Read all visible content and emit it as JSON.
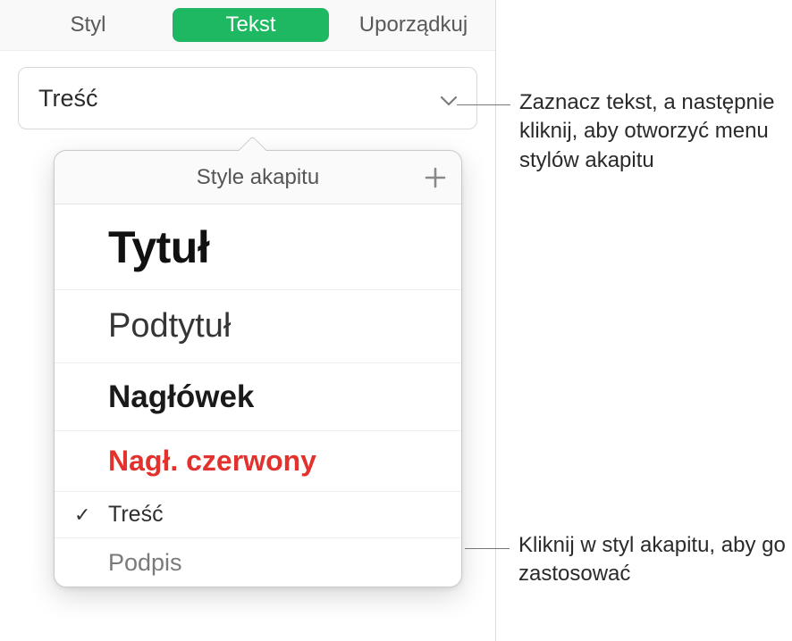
{
  "tabs": {
    "style": "Styl",
    "text": "Tekst",
    "arrange": "Uporządkuj"
  },
  "selector": {
    "current": "Treść"
  },
  "popover": {
    "title": "Style akapitu",
    "items": [
      {
        "label": "Tytuł",
        "class": "s-tytul",
        "checked": false
      },
      {
        "label": "Podtytuł",
        "class": "s-podtytul",
        "checked": false
      },
      {
        "label": "Nagłówek",
        "class": "s-naglowek",
        "checked": false
      },
      {
        "label": "Nagł. czerwony",
        "class": "s-nagl-czerwony",
        "checked": false
      },
      {
        "label": "Treść",
        "class": "s-tresc",
        "checked": true
      },
      {
        "label": "Podpis",
        "class": "s-podpis",
        "checked": false
      }
    ]
  },
  "callouts": {
    "c1": "Zaznacz tekst, a następnie kliknij, aby otworzyć menu stylów akapitu",
    "c2": "Kliknij w styl akapitu, aby go zastosować"
  }
}
